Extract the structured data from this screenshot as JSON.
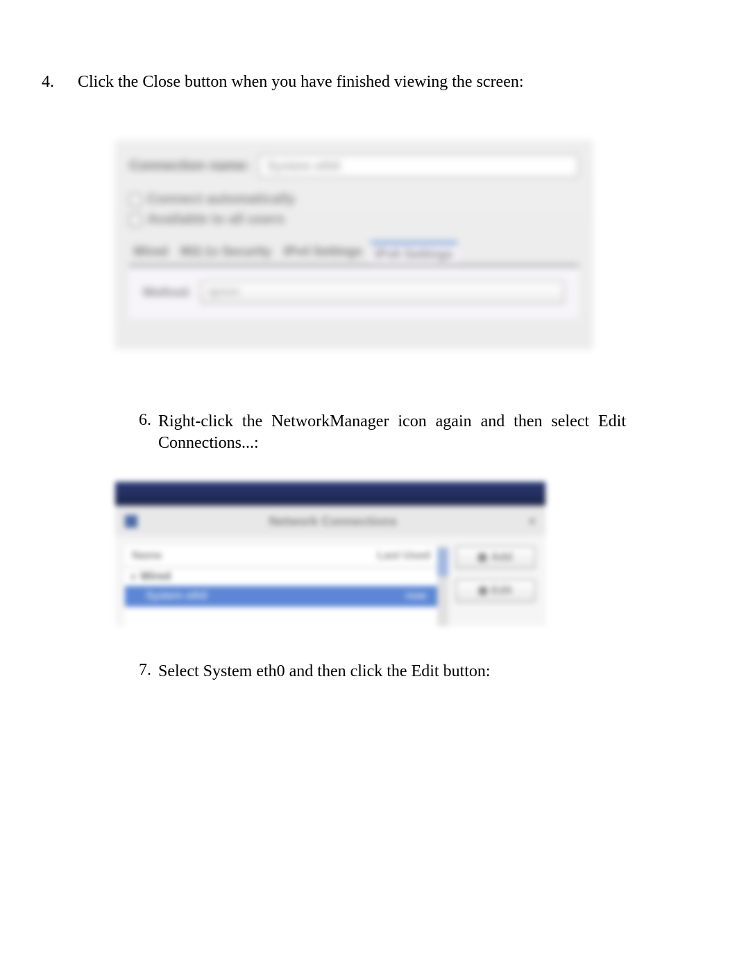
{
  "step4": {
    "num": "4.",
    "text": "Click the Close button when you have finished viewing the screen:"
  },
  "step6": {
    "num": "6.",
    "text": "Right-click the NetworkManager icon again and then select Edit Connections...:"
  },
  "step7": {
    "num": "7.",
    "text": "Select System eth0 and then click the Edit button:"
  },
  "dialog1": {
    "connection_name_label": "Connection name:",
    "connection_name_value": "System eth0",
    "chk1_label": "Connect automatically",
    "chk2_label": "Available to all users",
    "tabs": {
      "t1": "Wired",
      "t2": "802.1x Security",
      "t3": "IPv4 Settings",
      "t4": "IPv6 Settings"
    },
    "method_label": "Method:",
    "method_value": "Ignore"
  },
  "dialog2": {
    "title": "Network Connections",
    "col_name": "Name",
    "col_last": "Last Used",
    "group": "Wired",
    "selected_name": "System eth0",
    "selected_last": "now",
    "btn_add": "Add",
    "btn_edit": "Edit"
  }
}
